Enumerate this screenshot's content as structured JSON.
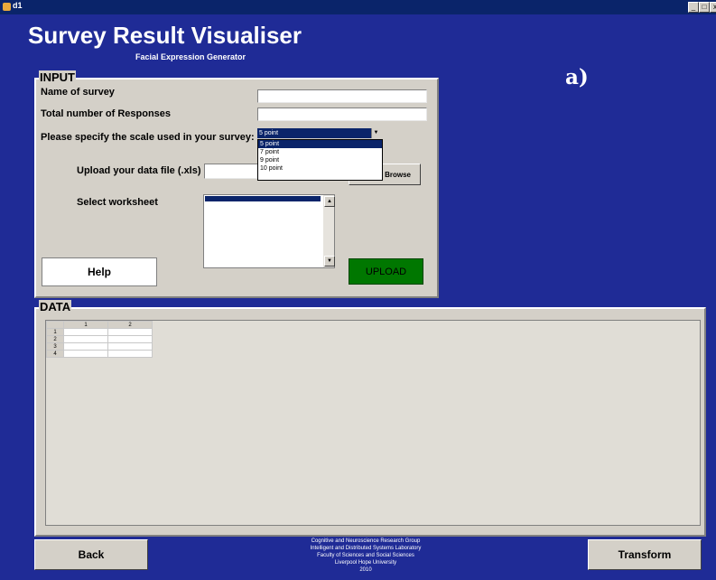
{
  "window": {
    "title": "d1",
    "controls": [
      "_",
      "□",
      "x"
    ]
  },
  "app": {
    "title": "Survey Result Visualiser",
    "subtitle": "Facial Expression Generator",
    "figure_label": "a)"
  },
  "input_panel": {
    "title": "INPUT",
    "name_label": "Name of survey",
    "name_value": "",
    "responses_label": "Total number of Responses",
    "responses_value": "",
    "scale_label": "Please specify the scale used in your survey:",
    "scale_selected": "5 point",
    "scale_options": [
      "5 point",
      "7 point",
      "9 point",
      "10 point"
    ],
    "upload_label": "Upload your data file (.xls)",
    "browse_label": "Browse",
    "worksheet_label": "Select worksheet",
    "help_label": "Help",
    "upload_button": "UPLOAD"
  },
  "data_panel": {
    "title": "DATA",
    "columns": [
      "1",
      "2"
    ],
    "rows": [
      "1",
      "2",
      "3",
      "4"
    ]
  },
  "footer": {
    "back_label": "Back",
    "transform_label": "Transform",
    "credits": [
      "Cognitive and Neuroscience Research Group",
      "Intelligent and Distributed Systems Laboratory",
      "Faculty of Sciences and Social Sciences",
      "Liverpool Hope University",
      "2010"
    ]
  },
  "colors": {
    "background": "#1f2b96",
    "panel": "#d4d0c8",
    "upload_button": "#007700",
    "selection": "#0a246a"
  }
}
